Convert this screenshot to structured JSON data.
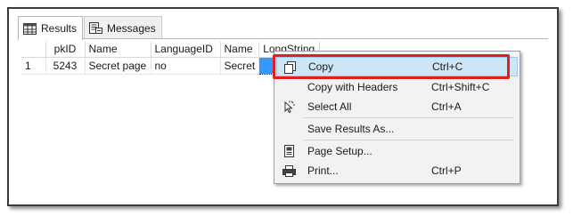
{
  "tabs": [
    {
      "label": "Results",
      "active": true,
      "icon": "grid-icon"
    },
    {
      "label": "Messages",
      "active": false,
      "icon": "messages-icon"
    }
  ],
  "grid": {
    "columns": [
      "",
      "pkID",
      "Name",
      "LanguageID",
      "Name",
      "LongString"
    ],
    "rows": [
      [
        "1",
        "5243",
        "Secret page",
        "no",
        "Secret",
        ""
      ]
    ]
  },
  "context_menu": {
    "items": [
      {
        "label": "Copy",
        "shortcut": "Ctrl+C",
        "icon": "copy-icon",
        "highlighted": true
      },
      {
        "label": "Copy with Headers",
        "shortcut": "Ctrl+Shift+C",
        "icon": ""
      },
      {
        "label": "Select All",
        "shortcut": "Ctrl+A",
        "icon": "select-all-icon"
      },
      {
        "label": "Save Results As...",
        "shortcut": "",
        "icon": ""
      },
      {
        "label": "Page Setup...",
        "shortcut": "",
        "icon": "page-setup-icon"
      },
      {
        "label": "Print...",
        "shortcut": "Ctrl+P",
        "icon": "printer-icon"
      }
    ]
  },
  "colors": {
    "selection": "#3399ff",
    "menu_highlight": "#cde6f7",
    "annotation_red": "#e11f1f"
  }
}
